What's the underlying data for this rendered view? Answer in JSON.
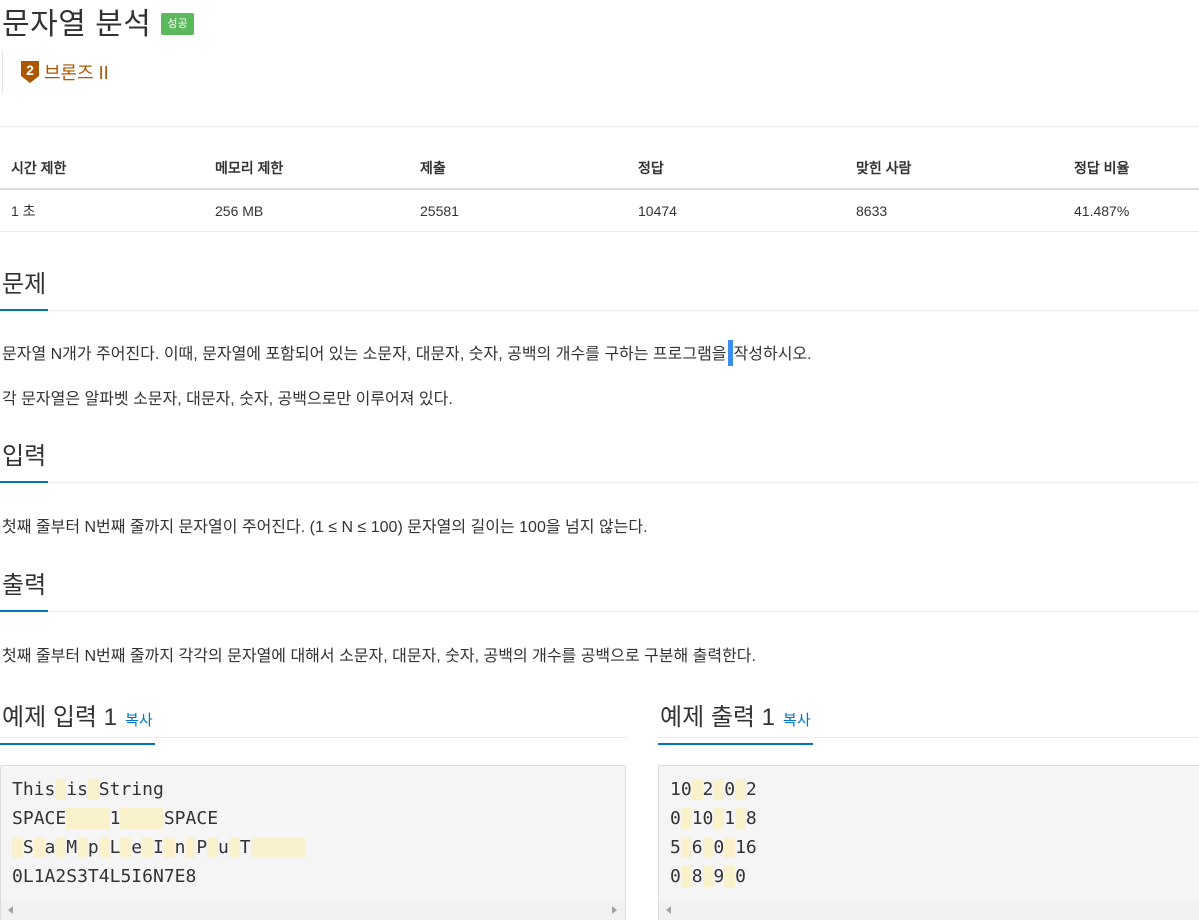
{
  "problem": {
    "title": "문자열 분석",
    "status_badge": "성공",
    "tier_number": "2",
    "tier_label": "브론즈 II",
    "tier_color": "#ad5600"
  },
  "stats": {
    "headers": [
      "시간 제한",
      "메모리 제한",
      "제출",
      "정답",
      "맞힌 사람",
      "정답 비율"
    ],
    "values": [
      "1 초",
      "256 MB",
      "25581",
      "10474",
      "8633",
      "41.487%"
    ]
  },
  "sections": {
    "problem_heading": "문제",
    "problem_p1_before_cursor": "문자열 N개가 주어진다. 이때, 문자열에 포함되어 있는 소문자, 대문자, 숫자, 공백의 개수를 구하는 프로그램을",
    "problem_p1_after_cursor": "작성하시오.",
    "problem_p2": "각 문자열은 알파벳 소문자, 대문자, 숫자, 공백으로만 이루어져 있다.",
    "input_heading": "입력",
    "input_p1": "첫째 줄부터 N번째 줄까지 문자열이 주어진다. (1 ≤ N ≤ 100) 문자열의 길이는 100을 넘지 않는다.",
    "output_heading": "출력",
    "output_p1": "첫째 줄부터 N번째 줄까지 각각의 문자열에 대해서 소문자, 대문자, 숫자, 공백의 개수를 공백으로 구분해 출력한다."
  },
  "sample_input": {
    "heading": "예제 입력 1",
    "copy_label": "복사",
    "lines": [
      "This is String",
      "SPACE    1    SPACE",
      " S a M p L e I n P u T     ",
      "0L1A2S3T4L5I6N7E8"
    ]
  },
  "sample_output": {
    "heading": "예제 출력 1",
    "copy_label": "복사",
    "lines": [
      "10 2 0 2",
      "0 10 1 8",
      "5 6 0 16",
      "0 8 9 0"
    ]
  },
  "colors": {
    "accent": "#0076c0",
    "success": "#5cb85c",
    "space_highlight": "#faf1cd",
    "cursor": "#3b8ef0"
  }
}
